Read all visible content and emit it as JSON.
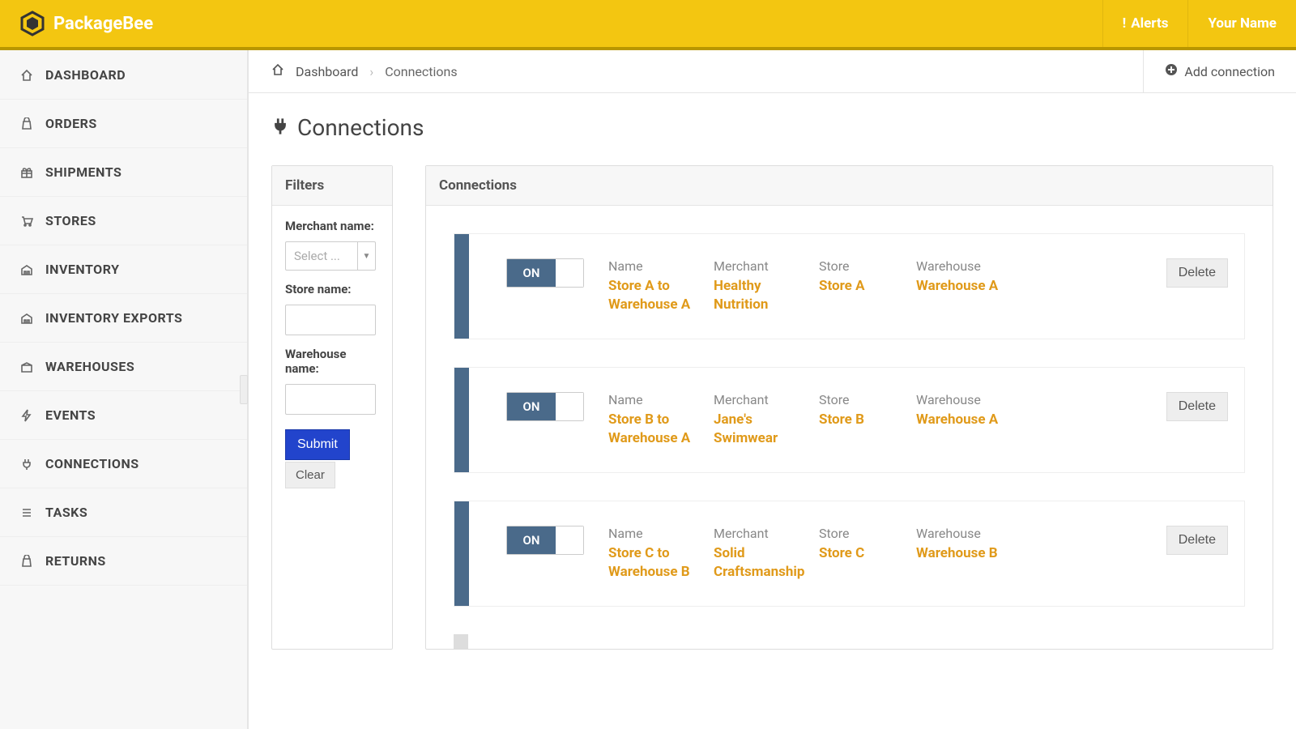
{
  "brand": "PackageBee",
  "header": {
    "alerts_label": "Alerts",
    "username": "Your Name"
  },
  "sidebar": {
    "items": [
      {
        "label": "DASHBOARD",
        "icon": "home-icon"
      },
      {
        "label": "ORDERS",
        "icon": "bag-icon"
      },
      {
        "label": "SHIPMENTS",
        "icon": "gift-icon"
      },
      {
        "label": "STORES",
        "icon": "cart-icon"
      },
      {
        "label": "INVENTORY",
        "icon": "warehouse-icon"
      },
      {
        "label": "INVENTORY EXPORTS",
        "icon": "warehouse-icon"
      },
      {
        "label": "WAREHOUSES",
        "icon": "warehouse-icon"
      },
      {
        "label": "EVENTS",
        "icon": "bolt-icon"
      },
      {
        "label": "CONNECTIONS",
        "icon": "plug-icon"
      },
      {
        "label": "TASKS",
        "icon": "list-icon"
      },
      {
        "label": "RETURNS",
        "icon": "bag-icon"
      }
    ]
  },
  "breadcrumb": {
    "items": [
      "Dashboard",
      "Connections"
    ]
  },
  "topline_action": "Add connection",
  "page_title": "Connections",
  "filters": {
    "panel_title": "Filters",
    "merchant_label": "Merchant name:",
    "merchant_placeholder": "Select ...",
    "store_label": "Store name:",
    "store_value": "",
    "warehouse_label": "Warehouse name:",
    "warehouse_value": "",
    "submit_label": "Submit",
    "clear_label": "Clear"
  },
  "connections_panel_title": "Connections",
  "field_labels": {
    "name": "Name",
    "merchant": "Merchant",
    "store": "Store",
    "warehouse": "Warehouse"
  },
  "toggle_on_label": "ON",
  "delete_label": "Delete",
  "connections": [
    {
      "name": "Store A to Warehouse A",
      "merchant": "Healthy Nutrition",
      "store": "Store A",
      "warehouse": "Warehouse A"
    },
    {
      "name": "Store B to Warehouse A",
      "merchant": "Jane's Swimwear",
      "store": "Store B",
      "warehouse": "Warehouse A"
    },
    {
      "name": "Store C to Warehouse B",
      "merchant": "Solid Craftsmanship",
      "store": "Store C",
      "warehouse": "Warehouse B"
    }
  ]
}
